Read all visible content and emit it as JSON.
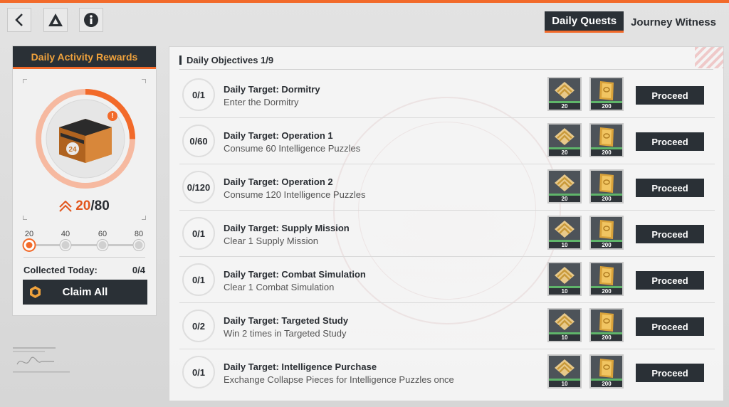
{
  "topbar": {
    "tabs": [
      {
        "label": "Daily Quests",
        "active": true
      },
      {
        "label": "Journey Witness",
        "active": false
      }
    ],
    "icons": [
      "back-arrow-icon",
      "triangle-logo-icon",
      "info-icon"
    ]
  },
  "left_panel": {
    "title": "Daily Activity Rewards",
    "activity": {
      "current": "20",
      "separator": "/",
      "max": "80"
    },
    "alert_badge": "!",
    "chest_badge": "24",
    "milestones": [
      {
        "label": "20",
        "active": true
      },
      {
        "label": "40",
        "active": false
      },
      {
        "label": "60",
        "active": false
      },
      {
        "label": "80",
        "active": false
      }
    ],
    "collected_label": "Collected Today:",
    "collected_value": "0/4",
    "claim_label": "Claim All"
  },
  "objectives": {
    "title": "Daily Objectives 1/9",
    "proceed_label": "Proceed",
    "quests": [
      {
        "progress": "0/1",
        "title": "Daily Target: Dormitry",
        "desc": "Enter the Dormitry",
        "reward_a": "20",
        "reward_b": "200"
      },
      {
        "progress": "0/60",
        "title": "Daily Target: Operation 1",
        "desc": "Consume 60 Intelligence Puzzles",
        "reward_a": "20",
        "reward_b": "200"
      },
      {
        "progress": "0/120",
        "title": "Daily Target: Operation 2",
        "desc": "Consume 120 Intelligence Puzzles",
        "reward_a": "20",
        "reward_b": "200"
      },
      {
        "progress": "0/1",
        "title": "Daily Target: Supply Mission",
        "desc": "Clear 1 Supply Mission",
        "reward_a": "10",
        "reward_b": "200"
      },
      {
        "progress": "0/1",
        "title": "Daily Target: Combat Simulation",
        "desc": "Clear 1 Combat Simulation",
        "reward_a": "10",
        "reward_b": "200"
      },
      {
        "progress": "0/2",
        "title": "Daily Target: Targeted Study",
        "desc": "Win 2 times in Targeted Study",
        "reward_a": "10",
        "reward_b": "200"
      },
      {
        "progress": "0/1",
        "title": "Daily Target: Intelligence Purchase",
        "desc": "Exchange Collapse Pieces for Intelligence Puzzles once",
        "reward_a": "10",
        "reward_b": "200"
      }
    ]
  },
  "colors": {
    "accent": "#f26a2a",
    "dark": "#2a3036",
    "gold": "#f0a23c",
    "green": "#5fb56a"
  }
}
